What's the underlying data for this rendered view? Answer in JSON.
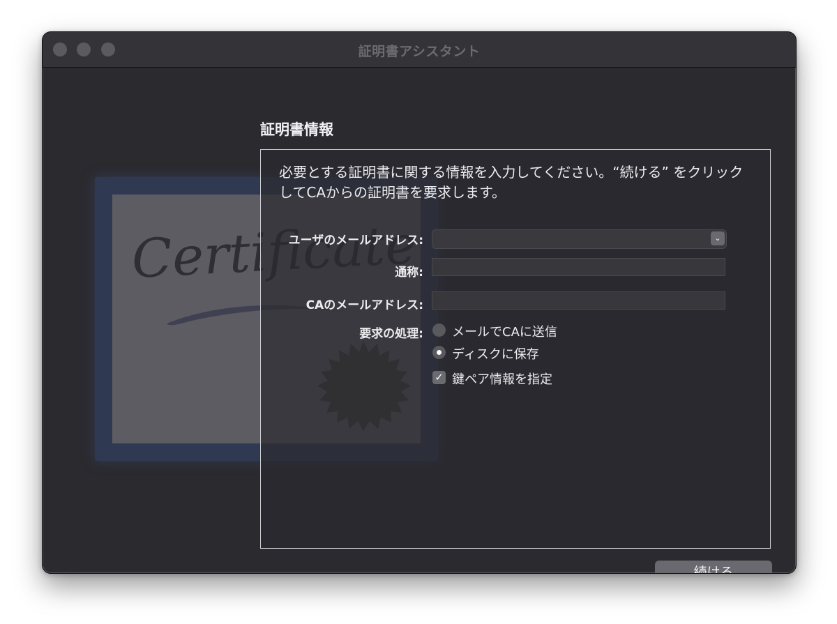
{
  "window": {
    "title": "証明書アシスタント"
  },
  "certificate_image": {
    "script_text": "Certificate"
  },
  "section": {
    "title": "証明書情報",
    "intro": "必要とする証明書に関する情報を入力してください。“続ける” をクリックしてCAからの証明書を要求します。"
  },
  "form": {
    "email_label": "ユーザのメールアドレス:",
    "email_value": "",
    "common_name_label": "通称:",
    "common_name_value": "",
    "ca_email_label": "CAのメールアドレス:",
    "ca_email_value": "",
    "request_label": "要求の処理:",
    "option_email_ca": "メールでCAに送信",
    "option_save_disk": "ディスクに保存",
    "selected_option": "ディスクに保存",
    "keypair_label": "鍵ペア情報を指定",
    "keypair_checked": true
  },
  "buttons": {
    "continue": "続ける"
  }
}
